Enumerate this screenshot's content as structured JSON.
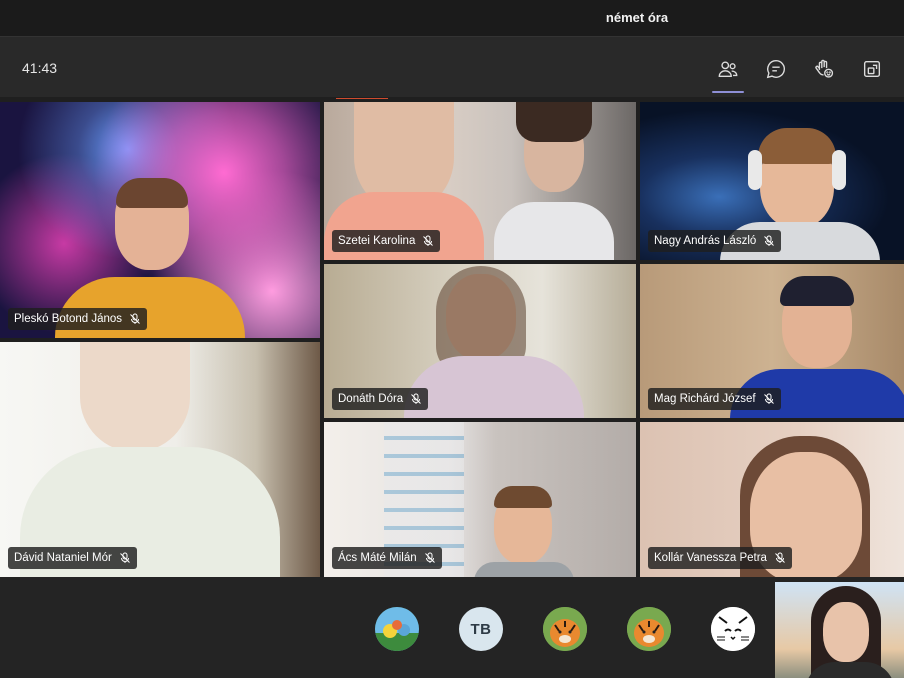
{
  "window": {
    "title": "német óra"
  },
  "toolbar": {
    "timer": "41:43",
    "buttons": [
      {
        "icon": "people-icon",
        "active": true
      },
      {
        "icon": "chat-icon",
        "active": false
      },
      {
        "icon": "raise-hand-icon",
        "active": false
      },
      {
        "icon": "share-screen-icon",
        "active": false
      }
    ]
  },
  "participants": [
    {
      "name": "Pleskó Botond János",
      "muted": true
    },
    {
      "name": "Szetei Karolina",
      "muted": true
    },
    {
      "name": "Nagy András László",
      "muted": true
    },
    {
      "name": "Donáth Dóra",
      "muted": true
    },
    {
      "name": "Mag Richárd József",
      "muted": true
    },
    {
      "name": "Dávid Nataniel Mór",
      "muted": true
    },
    {
      "name": "Ács Máté Milán",
      "muted": true
    },
    {
      "name": "Kollár Vanessza Petra",
      "muted": true
    }
  ],
  "overflow_avatars": [
    {
      "type": "image",
      "icon": "pokemon-avatar-icon"
    },
    {
      "type": "initials",
      "initials": "TB"
    },
    {
      "type": "image",
      "icon": "tiger-avatar-icon"
    },
    {
      "type": "image",
      "icon": "tiger-avatar-icon"
    },
    {
      "type": "image",
      "icon": "cat-avatar-icon"
    }
  ],
  "colors": {
    "accent": "#8e8fd6",
    "background": "#1f1f1f",
    "toolbar": "#292929",
    "nametag": "#1e1e1e"
  }
}
